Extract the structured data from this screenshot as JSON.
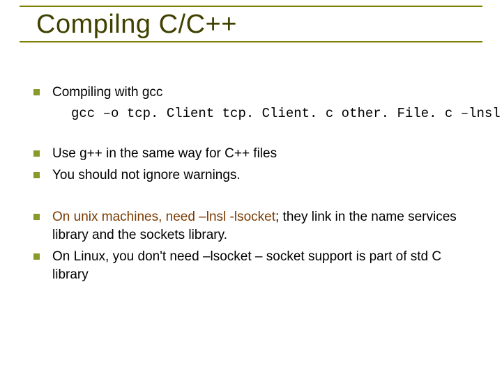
{
  "title": "Compilng C/C++",
  "groups": [
    {
      "items": [
        {
          "text": "Compiling with gcc",
          "code": "gcc –o tcp. Client tcp. Client. c other. File. c –lnsl"
        }
      ]
    },
    {
      "items": [
        {
          "text": "Use g++ in the same way for C++ files"
        },
        {
          "text": "You should not ignore warnings."
        }
      ]
    },
    {
      "items": [
        {
          "brown_lead": "On unix machines, need –lnsl -lsocket",
          "rest": "; they link in the name services library and the sockets library."
        },
        {
          "text": "On Linux, you don't need –lsocket – socket support is part of std C library"
        }
      ]
    }
  ]
}
